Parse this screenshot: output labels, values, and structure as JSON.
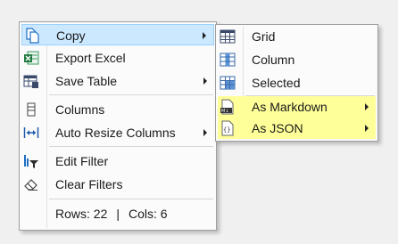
{
  "main_menu": {
    "items": [
      {
        "label": "Copy",
        "icon": "copy-icon",
        "submenu": true,
        "highlighted": true
      },
      {
        "label": "Export Excel",
        "icon": "excel-icon",
        "submenu": false
      },
      {
        "label": "Save Table",
        "icon": "save-table-icon",
        "submenu": true
      },
      {
        "label": "Columns",
        "icon": "columns-icon",
        "submenu": false
      },
      {
        "label": "Auto Resize Columns",
        "icon": "resize-columns-icon",
        "submenu": true
      },
      {
        "label": "Edit Filter",
        "icon": "filter-icon",
        "submenu": false
      },
      {
        "label": "Clear Filters",
        "icon": "eraser-icon",
        "submenu": false
      }
    ],
    "status": {
      "rows_label": "Rows: 22",
      "separator": "|",
      "cols_label": "Cols: 6"
    }
  },
  "copy_submenu": {
    "items": [
      {
        "label": "Grid",
        "icon": "grid-icon",
        "submenu": false
      },
      {
        "label": "Column",
        "icon": "column-icon",
        "submenu": false
      },
      {
        "label": "Selected",
        "icon": "selected-cells-icon",
        "submenu": false
      },
      {
        "label": "As Markdown",
        "icon": "markdown-file-icon",
        "submenu": true
      },
      {
        "label": "As JSON",
        "icon": "json-file-icon",
        "submenu": true
      }
    ]
  },
  "colors": {
    "highlight": "#cce8ff",
    "highlight_border": "#99d1ff",
    "yellow": "#ffff99"
  }
}
